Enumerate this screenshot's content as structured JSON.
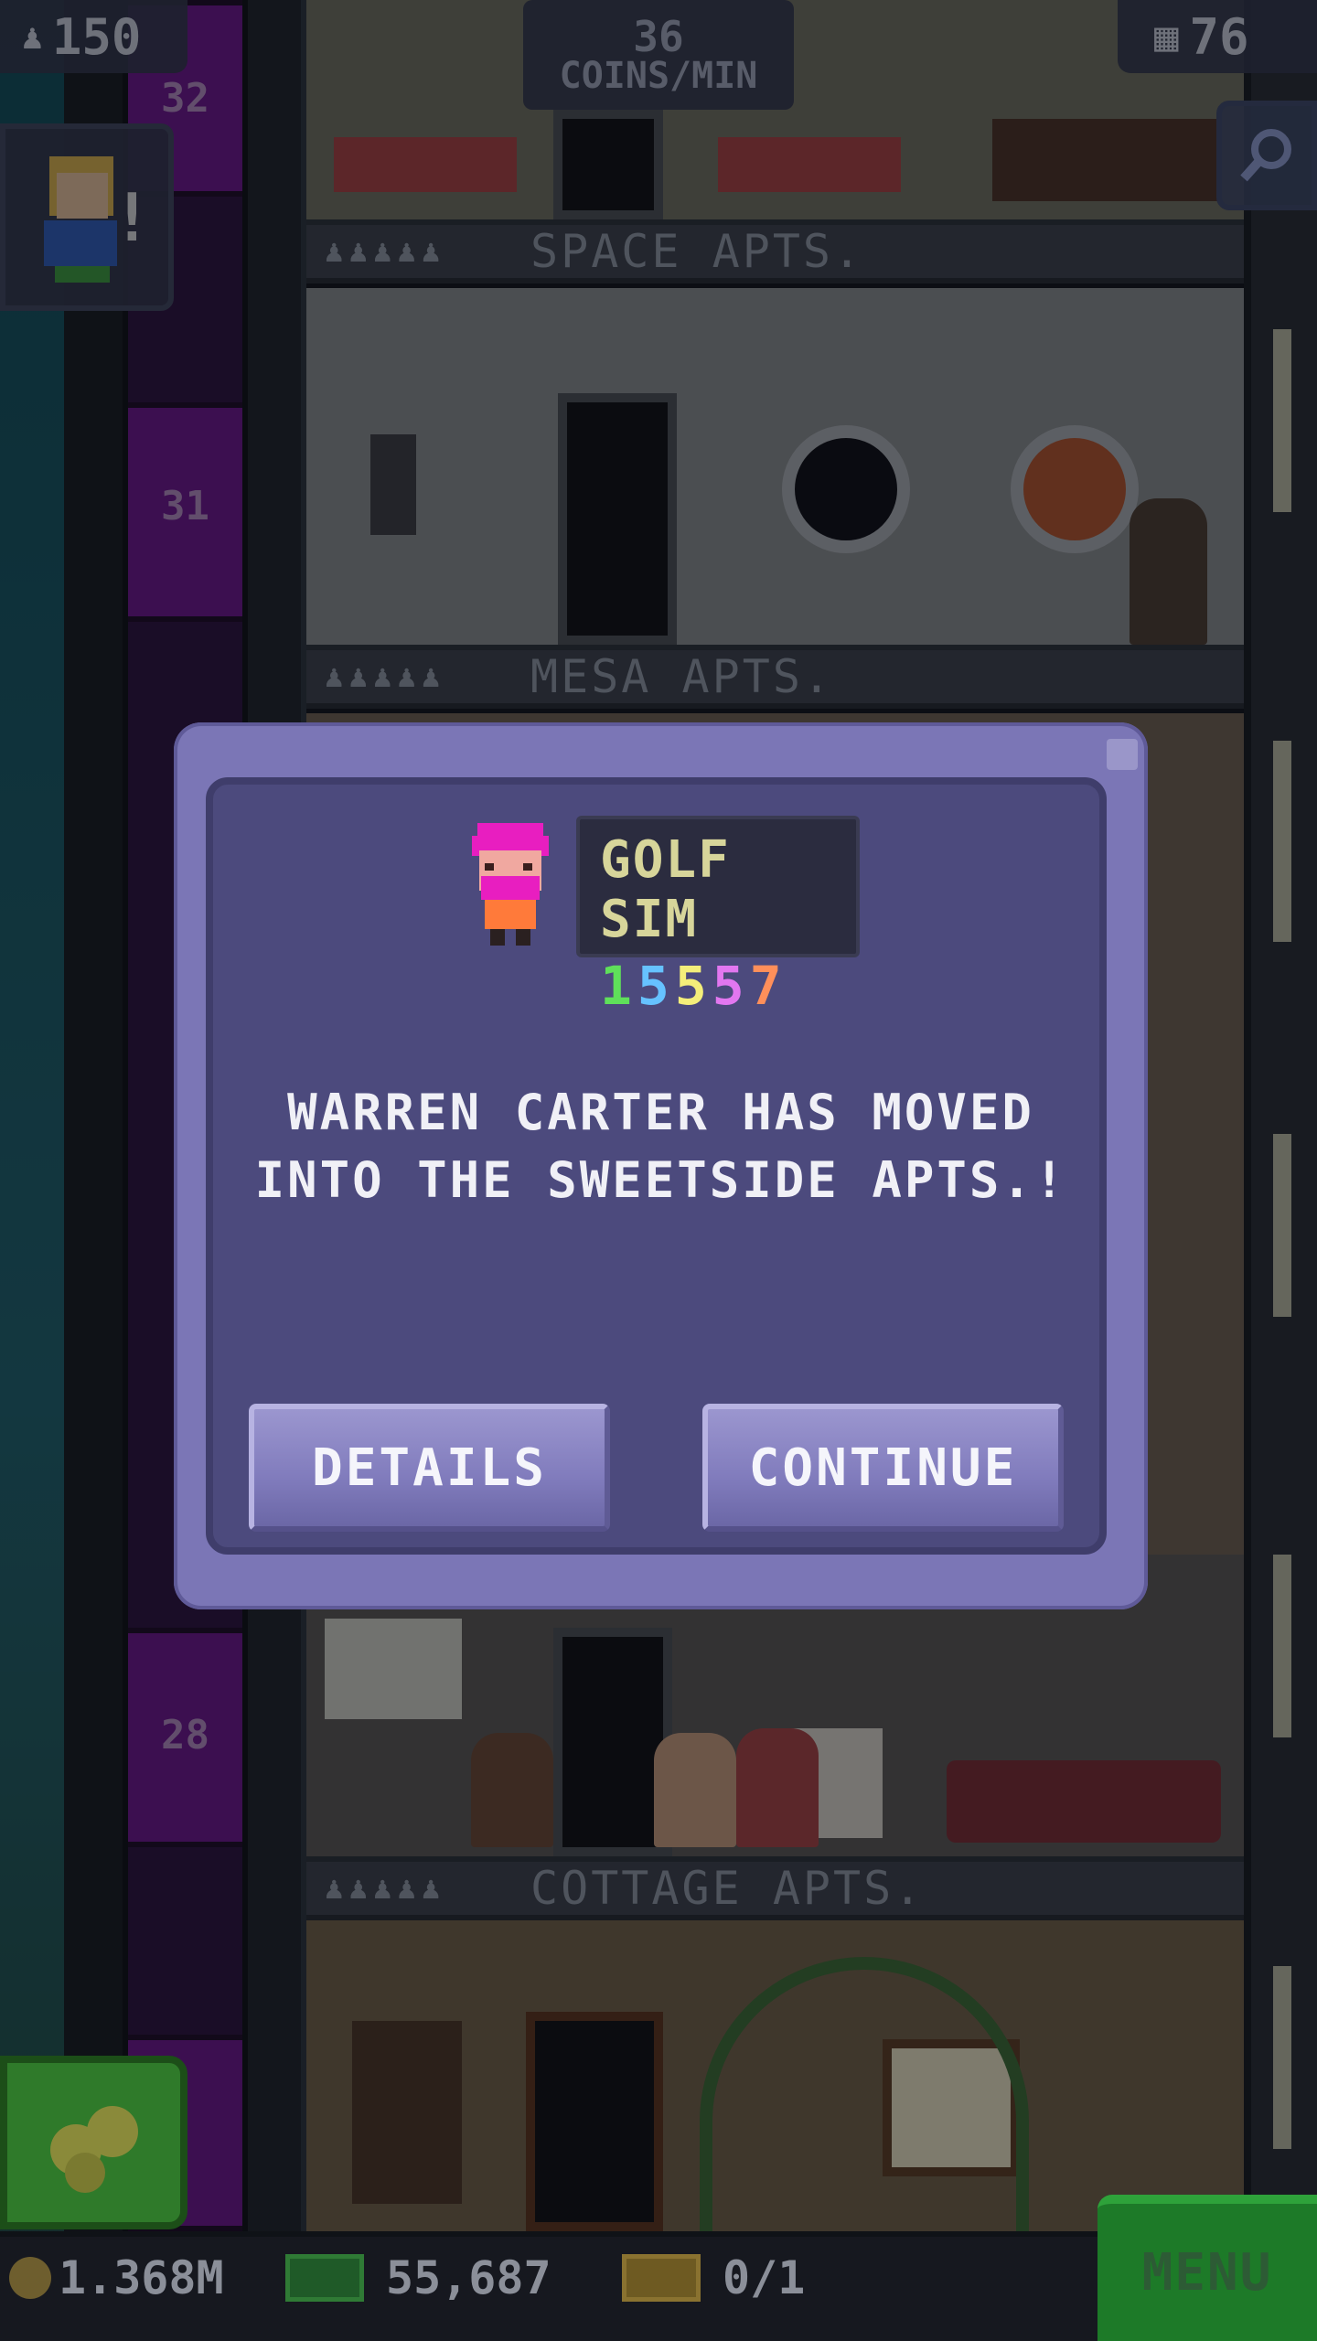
{
  "hud": {
    "population": "150",
    "coins_per_min_value": "36",
    "coins_per_min_unit": "COINS/MIN",
    "floors": "76"
  },
  "tower": {
    "floor_labels": [
      "SPACE APTS.",
      "MESA APTS.",
      "COTTAGE APTS."
    ],
    "elevator_floors": [
      "32",
      "31",
      "28"
    ]
  },
  "dialog": {
    "job_title": "GOLF SIM",
    "bitizen_id_digits": [
      "1",
      "5",
      "5",
      "5",
      "7"
    ],
    "message_line1": "WARREN CARTER HAS MOVED",
    "message_line2": "INTO THE SWEETSIDE APTS.!",
    "details_label": "DETAILS",
    "continue_label": "CONTINUE"
  },
  "bottom_bar": {
    "coins": "1.368M",
    "bux": "55,687",
    "tickets": "0/1",
    "menu_label": "MENU"
  },
  "colors": {
    "dialog_frame": "#7b76b6",
    "dialog_body": "#4c4a7d",
    "menu_green": "#1d7a28",
    "elevator_purple": "#6a1289"
  }
}
